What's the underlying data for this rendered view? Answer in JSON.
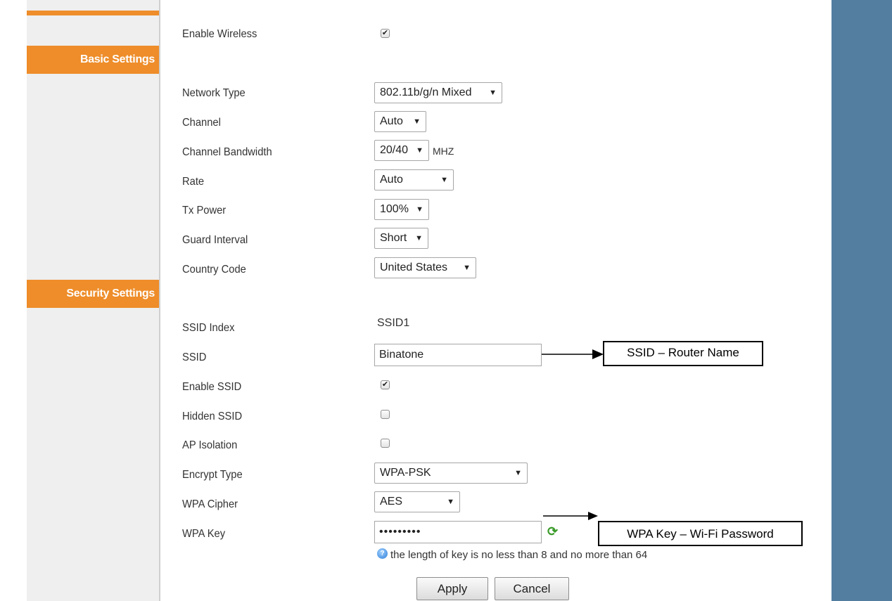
{
  "sidebar": {
    "sections": [
      {
        "label": "Basic Settings"
      },
      {
        "label": "Security Settings"
      }
    ]
  },
  "form": {
    "enable_wireless": {
      "label": "Enable Wireless",
      "checked": true
    },
    "network_type": {
      "label": "Network Type",
      "value": "802.11b/g/n Mixed"
    },
    "channel": {
      "label": "Channel",
      "value": "Auto"
    },
    "channel_bandwidth": {
      "label": "Channel Bandwidth",
      "value": "20/40",
      "unit": "MHZ"
    },
    "rate": {
      "label": "Rate",
      "value": "Auto"
    },
    "tx_power": {
      "label": "Tx Power",
      "value": "100%"
    },
    "guard_interval": {
      "label": "Guard Interval",
      "value": "Short"
    },
    "country_code": {
      "label": "Country Code",
      "value": "United States"
    },
    "ssid_index": {
      "label": "SSID Index",
      "value": "SSID1"
    },
    "ssid": {
      "label": "SSID",
      "value": "Binatone"
    },
    "enable_ssid": {
      "label": "Enable SSID",
      "checked": true
    },
    "hidden_ssid": {
      "label": "Hidden SSID",
      "checked": false
    },
    "ap_isolation": {
      "label": "AP Isolation",
      "checked": false
    },
    "encrypt_type": {
      "label": "Encrypt Type",
      "value": "WPA-PSK"
    },
    "wpa_cipher": {
      "label": "WPA Cipher",
      "value": "AES"
    },
    "wpa_key": {
      "label": "WPA Key",
      "value": "•••••••••"
    },
    "key_hint": "the length of key is no less than 8 and no more than 64"
  },
  "buttons": {
    "apply": "Apply",
    "cancel": "Cancel"
  },
  "annotations": {
    "ssid_callout": "SSID – Router Name",
    "wpa_callout": "WPA Key – Wi-Fi Password"
  },
  "colors": {
    "accent": "#ee8d2a",
    "right_panel": "#537ea0",
    "sidebar": "#efefef"
  },
  "icons": {
    "select_arrow": "dropdown-arrow-icon",
    "info": "info-icon",
    "refresh": "refresh-icon"
  }
}
